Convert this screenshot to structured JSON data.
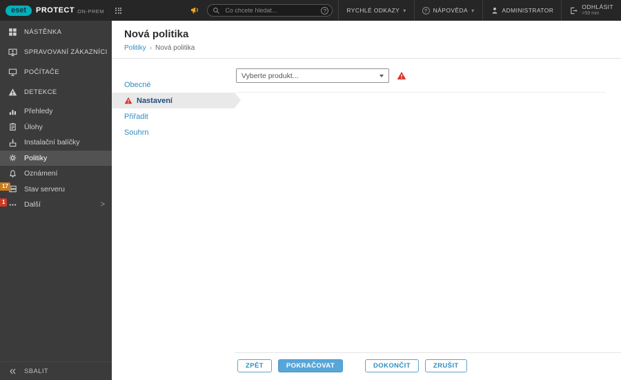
{
  "topbar": {
    "logo_text": "eset",
    "product": "PROTECT",
    "edition": "ON-PREM",
    "search_placeholder": "Co chcete hledat...",
    "help_circle": "?",
    "quick_links_label": "RYCHLÉ ODKAZY",
    "help_label": "NÁPOVĚDA",
    "user_label": "ADMINISTRATOR",
    "logout_label": "ODHLÁSIT",
    "session_remaining": ">59 min"
  },
  "sidebar": {
    "items": [
      {
        "label": "NÁSTĚNKA",
        "icon": "dashboard-icon"
      },
      {
        "label": "SPRAVOVANÍ ZÁKAZNÍCI",
        "icon": "customers-icon"
      },
      {
        "label": "POČÍTAČE",
        "icon": "computers-icon"
      },
      {
        "label": "DETEKCE",
        "icon": "detections-icon"
      },
      {
        "label": "Přehledy",
        "icon": "reports-icon"
      },
      {
        "label": "Úlohy",
        "icon": "tasks-icon"
      },
      {
        "label": "Instalační balíčky",
        "icon": "installers-icon"
      },
      {
        "label": "Politiky",
        "icon": "policies-icon",
        "selected": true
      },
      {
        "label": "Oznámení",
        "icon": "notifications-icon"
      },
      {
        "label": "Stav serveru",
        "icon": "server-icon"
      },
      {
        "label": "Další",
        "icon": "more-icon",
        "chevron": ">"
      }
    ],
    "badges": [
      {
        "value": "17",
        "color": "#c97a1f"
      },
      {
        "value": "1",
        "color": "#cc3a28"
      }
    ],
    "collapse_label": "SBALIT"
  },
  "page": {
    "title": "Nová politika",
    "breadcrumb_root": "Politiky",
    "breadcrumb_sep": "›",
    "breadcrumb_current": "Nová politika"
  },
  "wizard": {
    "steps": [
      {
        "label": "Obecné"
      },
      {
        "label": "Nastavení",
        "selected": true,
        "warning": true
      },
      {
        "label": "Přiřadit"
      },
      {
        "label": "Souhrn"
      }
    ]
  },
  "content": {
    "product_select_value": "Vyberte produkt..."
  },
  "footer": {
    "buttons": [
      {
        "label": "ZPĚT"
      },
      {
        "label": "POKRAČOVAT",
        "primary": true
      },
      {
        "label": "DOKONČIT"
      },
      {
        "label": "ZRUŠIT"
      }
    ]
  },
  "colors": {
    "brand_cyan": "#00b0bd",
    "link_blue": "#2f8dc0",
    "primary_button": "#58a6d8",
    "alert_red": "#d9342b",
    "warning_orange": "#f5a21b"
  }
}
